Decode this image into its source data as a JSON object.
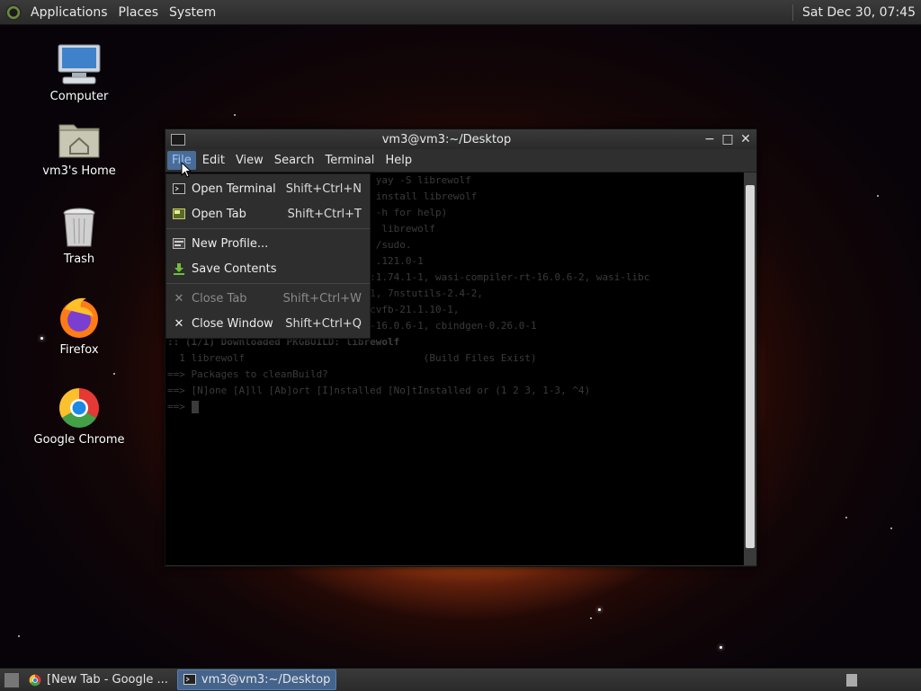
{
  "top_panel": {
    "menus": [
      "Applications",
      "Places",
      "System"
    ],
    "clock": "Sat Dec 30, 07:45"
  },
  "desktop_icons": [
    {
      "label": "Computer",
      "icon": "computer-icon"
    },
    {
      "label": "vm3's Home",
      "icon": "home-folder-icon"
    },
    {
      "label": "Trash",
      "icon": "trash-icon"
    },
    {
      "label": "Firefox",
      "icon": "firefox-icon"
    },
    {
      "label": "Google Chrome",
      "icon": "chrome-icon"
    }
  ],
  "terminal": {
    "title": "vm3@vm3:~/Desktop",
    "menus": [
      "File",
      "Edit",
      "View",
      "Search",
      "Terminal",
      "Help"
    ],
    "lines": [
      "                                   yay -S librewolf",
      "",
      "                                   install librewolf",
      "                              (use -h for help)",
      "                                    librewolf",
      "                                   /sudo.",
      "                                   .121.0-1",
      "                             asm-1:1.74.1-1, wasi-compiler-rt-16.0.6-2, wasi-libc",
      "                             10.2-1, 7nstutils-2.4-2, ",
      "                             rver-cvfb-21.1.10-1, ",
      "nasm-2.16.01-1, llvm-16.0.6-1, lld-16.0.6-1, cbindgen-0.26.0-1",
      ":: (1/1) Downloaded PKGBUILD: librewolf",
      "  1 librewolf                              (Build Files Exist)",
      "==> Packages to cleanBuild?",
      "==> [N]one [A]ll [Ab]ort [I]nstalled [No]tInstalled or (1 2 3, 1-3, ^4)",
      "==> "
    ]
  },
  "file_menu": [
    {
      "label": "Open Terminal",
      "shortcut": "Shift+Ctrl+N",
      "icon": "terminal-icon",
      "disabled": false
    },
    {
      "label": "Open Tab",
      "shortcut": "Shift+Ctrl+T",
      "icon": "new-tab-icon",
      "disabled": false
    },
    {
      "label": "New Profile...",
      "shortcut": "",
      "icon": "profile-icon",
      "disabled": false
    },
    {
      "label": "Save Contents",
      "shortcut": "",
      "icon": "save-icon",
      "disabled": false
    },
    {
      "label": "Close Tab",
      "shortcut": "Shift+Ctrl+W",
      "icon": "close-icon",
      "disabled": true
    },
    {
      "label": "Close Window",
      "shortcut": "Shift+Ctrl+Q",
      "icon": "close-icon",
      "disabled": false
    }
  ],
  "taskbar": {
    "tasks": [
      {
        "label": "[New Tab - Google ...",
        "icon": "chrome-icon",
        "active": false
      },
      {
        "label": "vm3@vm3:~/Desktop",
        "icon": "terminal-icon",
        "active": true
      }
    ]
  }
}
